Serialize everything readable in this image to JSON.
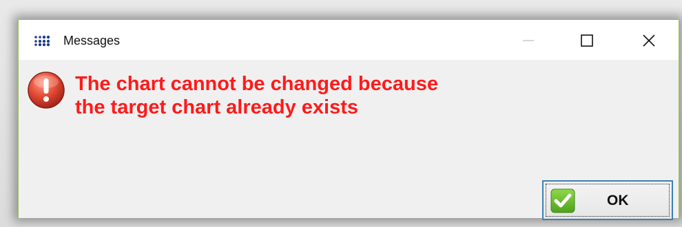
{
  "window": {
    "title": "Messages",
    "accent_color": "#9fc15b"
  },
  "titlebar_buttons": {
    "minimize_icon": "minimize-icon",
    "maximize_icon": "maximize-icon",
    "close_icon": "close-icon"
  },
  "message": {
    "icon": "error-icon",
    "text": " The chart cannot be changed because\nthe target chart already exists",
    "color": "#ff1a1a"
  },
  "ok_button": {
    "label": "OK",
    "icon": "checkmark-icon",
    "icon_color": "#6fbf2a"
  }
}
